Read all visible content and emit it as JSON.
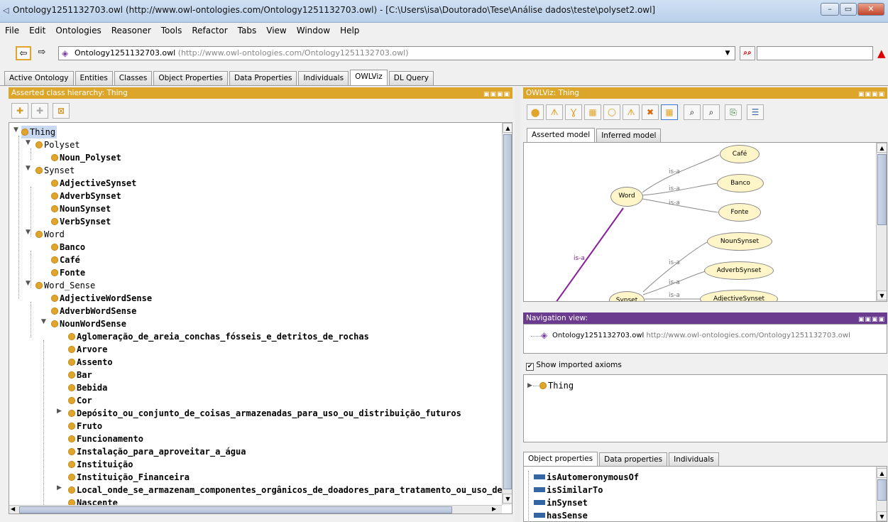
{
  "window": {
    "title": "Ontology1251132703.owl (http://www.owl-ontologies.com/Ontology1251132703.owl) - [C:\\Users\\isa\\Doutorado\\Tese\\Análise dados\\teste\\polyset2.owl]"
  },
  "menu": [
    "File",
    "Edit",
    "Ontologies",
    "Reasoner",
    "Tools",
    "Refactor",
    "Tabs",
    "View",
    "Window",
    "Help"
  ],
  "address": {
    "name": "Ontology1251132703.owl",
    "url": "(http://www.owl-ontologies.com/Ontology1251132703.owl)"
  },
  "tabs": [
    "Active Ontology",
    "Entities",
    "Classes",
    "Object Properties",
    "Data Properties",
    "Individuals",
    "OWLViz",
    "DL Query"
  ],
  "left_panel": {
    "title": "Asserted class hierarchy: Thing"
  },
  "tree": [
    {
      "label": "Thing",
      "bold": false
    },
    {
      "label": "Polyset",
      "bold": false
    },
    {
      "label": "Noun_Polyset",
      "bold": true
    },
    {
      "label": "Synset",
      "bold": false
    },
    {
      "label": "AdjectiveSynset",
      "bold": true
    },
    {
      "label": "AdverbSynset",
      "bold": true
    },
    {
      "label": "NounSynset",
      "bold": true
    },
    {
      "label": "VerbSynset",
      "bold": true
    },
    {
      "label": "Word",
      "bold": false
    },
    {
      "label": "Banco",
      "bold": true
    },
    {
      "label": "Café",
      "bold": true
    },
    {
      "label": "Fonte",
      "bold": true
    },
    {
      "label": "Word_Sense",
      "bold": false
    },
    {
      "label": "AdjectiveWordSense",
      "bold": true
    },
    {
      "label": "AdverbWordSense",
      "bold": true
    },
    {
      "label": "NounWordSense",
      "bold": true
    },
    {
      "label": "Aglomeração_de_areia_conchas_fósseis_e_detritos_de_rochas",
      "bold": true
    },
    {
      "label": "Arvore",
      "bold": true
    },
    {
      "label": "Assento",
      "bold": true
    },
    {
      "label": "Bar",
      "bold": true
    },
    {
      "label": "Bebida",
      "bold": true
    },
    {
      "label": "Cor",
      "bold": true
    },
    {
      "label": "Depósito_ou_conjunto_de_coisas_armazenadas_para_uso_ou_distribuição_futuros",
      "bold": true
    },
    {
      "label": "Fruto",
      "bold": true
    },
    {
      "label": "Funcionamento",
      "bold": true
    },
    {
      "label": "Instalação_para_aproveitar_a_água",
      "bold": true
    },
    {
      "label": "Instituição",
      "bold": true
    },
    {
      "label": "Instituição_Financeira",
      "bold": true
    },
    {
      "label": "Local_onde_se_armazenam_componentes_orgânicos_de_doadores_para_tratamento_ou_uso_de_",
      "bold": true
    },
    {
      "label": "Nascente",
      "bold": true
    }
  ],
  "viz": {
    "title": "OWLViz: Thing",
    "tabs": [
      "Asserted model",
      "Inferred model"
    ],
    "nodes": [
      "Café",
      "Word",
      "Banco",
      "Fonte",
      "NounSynset",
      "AdverbSynset",
      "Synset",
      "AdjectiveSynset"
    ],
    "edge_label": "is-a"
  },
  "nav": {
    "title": "Navigation view:",
    "ontology": "Ontology1251132703.owl",
    "url": "http://www.owl-ontologies.com/Ontology1251132703.owl",
    "show_imported": "Show imported axioms",
    "root": "Thing"
  },
  "prop_tabs": [
    "Object properties",
    "Data properties",
    "Individuals"
  ],
  "properties": [
    "isAutomeronymousOf",
    "isSimilarTo",
    "inSynset",
    "hasSense"
  ],
  "colors": {
    "panel_header": "#dba62a",
    "nav_header": "#6a3b8e",
    "class_dot": "#e0a52c",
    "edge_purple": "#8a1e9c"
  }
}
